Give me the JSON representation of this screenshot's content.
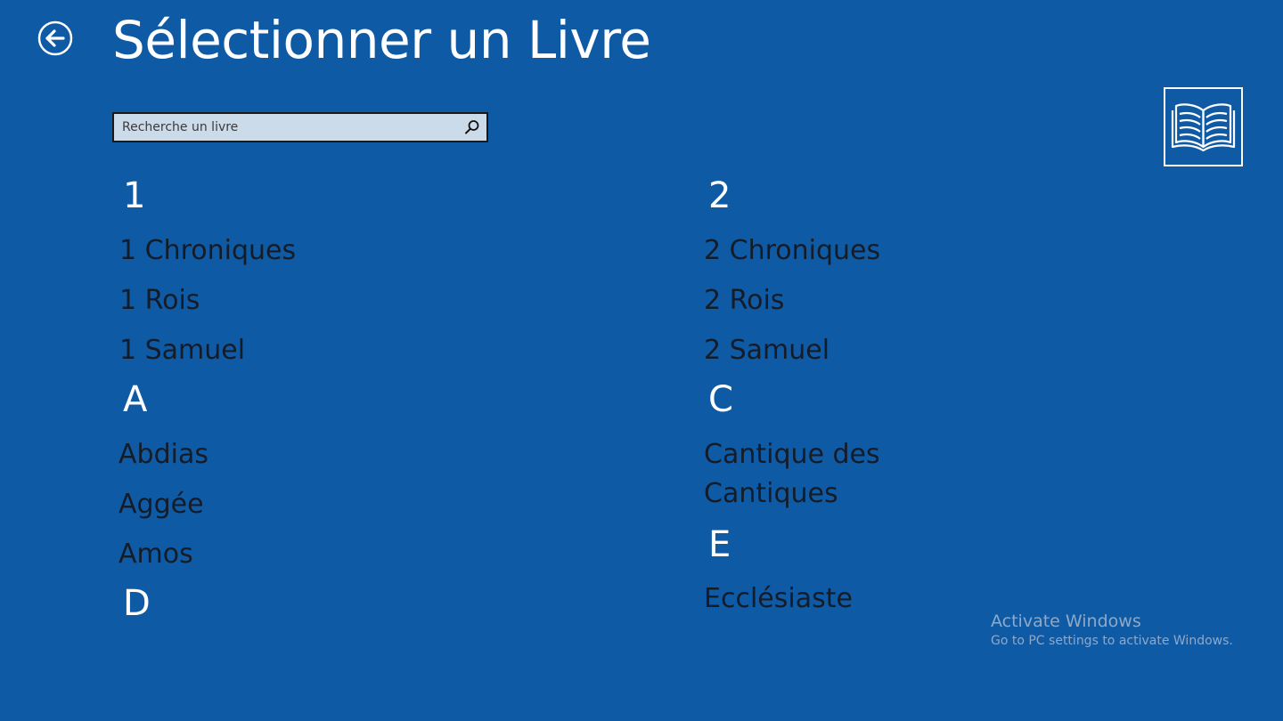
{
  "header": {
    "title": "Sélectionner un Livre",
    "back_icon": "back-arrow-icon"
  },
  "search": {
    "placeholder": "Recherche un livre",
    "value": "",
    "icon": "search-icon"
  },
  "tile": {
    "icon": "open-book-icon"
  },
  "groups": {
    "g1": {
      "header": "1",
      "items": [
        "1 Chroniques",
        "1 Rois",
        "1 Samuel"
      ]
    },
    "g2": {
      "header": "2",
      "items": [
        "2 Chroniques",
        "2 Rois",
        "2 Samuel"
      ]
    },
    "gA": {
      "header": "A",
      "items": [
        "Abdias",
        "Aggée",
        "Amos"
      ]
    },
    "gC": {
      "header": "C",
      "items": [
        "Cantique des Cantiques"
      ]
    },
    "gE": {
      "header": "E",
      "items": [
        "Ecclésiaste"
      ]
    },
    "gD": {
      "header": "D",
      "items": []
    }
  },
  "watermark": {
    "title": "Activate Windows",
    "subtitle": "Go to PC settings to activate Windows."
  },
  "colors": {
    "background": "#0f5aa5",
    "item_text": "#141c28",
    "header_text": "#ffffff",
    "search_bg": "#ccdbe9"
  }
}
